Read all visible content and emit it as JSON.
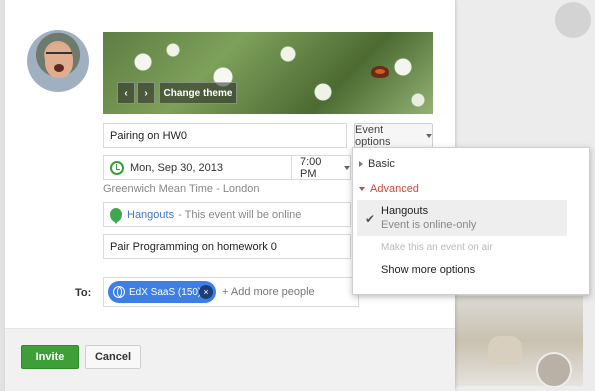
{
  "theme": {
    "prev_label": "‹",
    "next_label": "›",
    "change_label": "Change theme"
  },
  "event": {
    "title_value": "Pairing on HW0",
    "options_label": "Event options",
    "date_value": "Mon, Sep 30, 2013",
    "time_value": "7:00 PM",
    "timezone": "Greenwich Mean Time - London",
    "hangouts_label": "Hangouts",
    "hangouts_note": "- This event will be online",
    "description_value": "Pair Programming on homework 0"
  },
  "invite": {
    "to_label": "To:",
    "chip_label": "EdX SaaS (150)",
    "chip_remove": "×",
    "add_more_placeholder": "+ Add more people"
  },
  "footer": {
    "invite_label": "Invite",
    "cancel_label": "Cancel"
  },
  "menu": {
    "basic_label": "Basic",
    "advanced_label": "Advanced",
    "hangouts_title": "Hangouts",
    "hangouts_sub": "Event is online-only",
    "check": "✔",
    "onair_label": "Make this an event on air",
    "more_label": "Show more options"
  },
  "colors": {
    "invite_green": "#3e9e37",
    "chip_blue": "#3d7fe6",
    "advanced_red": "#d14836",
    "link_blue": "#3f77c8"
  }
}
